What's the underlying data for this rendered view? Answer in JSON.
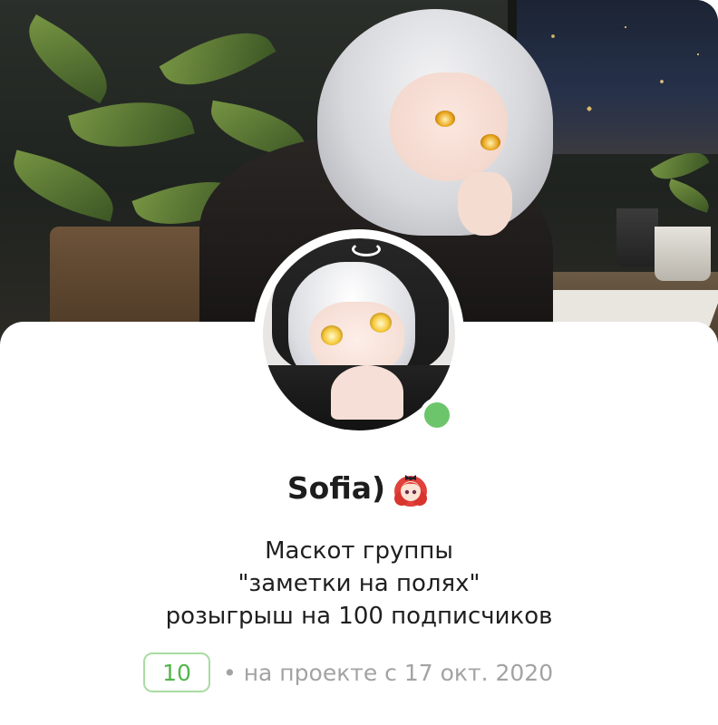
{
  "profile": {
    "name": "Sofia)",
    "name_emoji": "girl-with-red-hair-emoji",
    "online": true,
    "bio_lines": [
      "Маскот группы",
      "\"заметки на полях\"",
      "розыгрыш на 100 подписчиков"
    ],
    "level": "10",
    "joined_text": "• на проекте с 17 окт. 2020"
  },
  "colors": {
    "online_dot": "#6cc56a",
    "level_text": "#52b64c",
    "level_border": "#a9dca3",
    "meta_text": "#a3a3a3",
    "name_text": "#1d1d1d"
  }
}
